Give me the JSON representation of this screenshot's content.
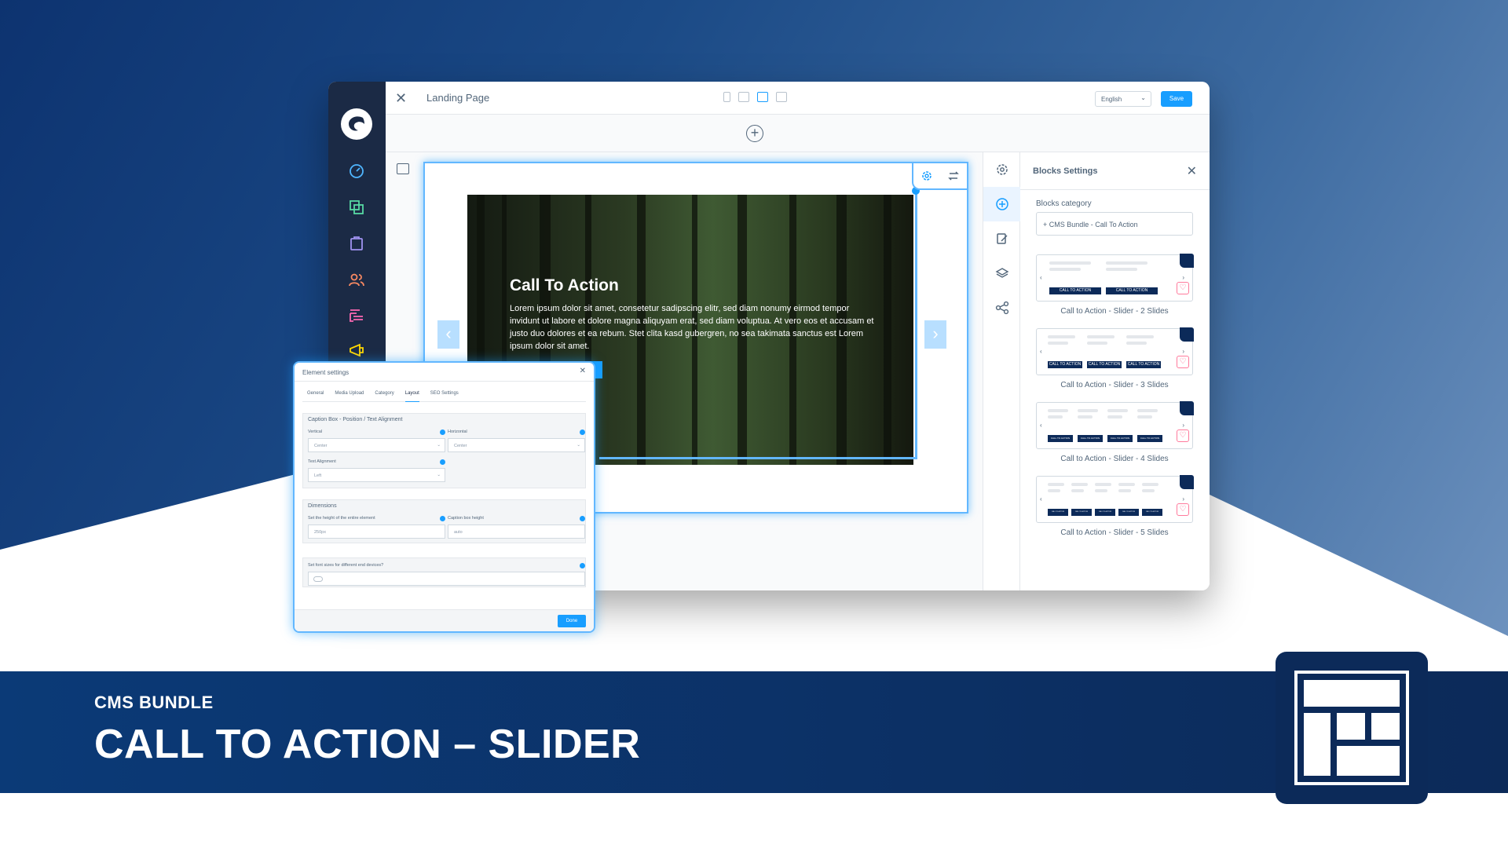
{
  "banner": {
    "subtitle": "CMS BUNDLE",
    "title": "CALL TO ACTION – SLIDER",
    "logo_icon": "layout-blocks-icon"
  },
  "topbar": {
    "page_title": "Landing Page",
    "devices": [
      "mobile-icon",
      "tablet-icon",
      "desktop-icon",
      "list-icon"
    ],
    "active_device": "desktop-icon",
    "language": "English",
    "save_label": "Save"
  },
  "sidebar": {
    "icons": [
      "shopware-logo",
      "dashboard-icon",
      "catalog-icon",
      "orders-icon",
      "customers-icon",
      "content-icon",
      "marketing-icon"
    ]
  },
  "slider": {
    "title": "Call To Action",
    "text": "Lorem ipsum dolor sit amet, consetetur sadipscing elitr, sed diam nonumy eirmod tempor invidunt ut labore et dolore magna aliquyam erat, sed diam voluptua. At vero eos et accusam et justo duo dolores et ea rebum. Stet clita kasd gubergren, no sea takimata sanctus est Lorem ipsum dolor sit amet."
  },
  "blocks_panel": {
    "title": "Blocks Settings",
    "category_label": "Blocks category",
    "category_value": "+ CMS Bundle - Call To Action",
    "blocks": [
      {
        "caption": "Call to Action - Slider - 2 Slides",
        "slides": 2
      },
      {
        "caption": "Call to Action - Slider - 3 Slides",
        "slides": 3
      },
      {
        "caption": "Call to Action - Slider - 4 Slides",
        "slides": 4
      },
      {
        "caption": "Call to Action - Slider - 5 Slides",
        "slides": 5
      }
    ],
    "mini_button_label": "CALL TO ACTION"
  },
  "element_settings": {
    "title": "Element settings",
    "tabs": [
      "General",
      "Media Upload",
      "Category",
      "Layout",
      "SEO Settings"
    ],
    "active_tab": "Layout",
    "caption_section": "Caption Box - Position / Text Alignment",
    "vertical_label": "Vertical",
    "vertical_value": "Center",
    "horizontal_label": "Horizontal",
    "horizontal_value": "Center",
    "text_align_label": "Text Alignment",
    "text_align_value": "Left",
    "dimensions_section": "Dimensions",
    "height_label": "Set the height of the entire element",
    "height_value": "250px",
    "caption_height_label": "Caption box height",
    "caption_height_value": "auto",
    "font_sizes_label": "Set font sizes for different end devices?",
    "done_label": "Done"
  },
  "colors": {
    "accent": "#189eff",
    "navy": "#0c2a59",
    "sidebar": "#1b2a45"
  }
}
